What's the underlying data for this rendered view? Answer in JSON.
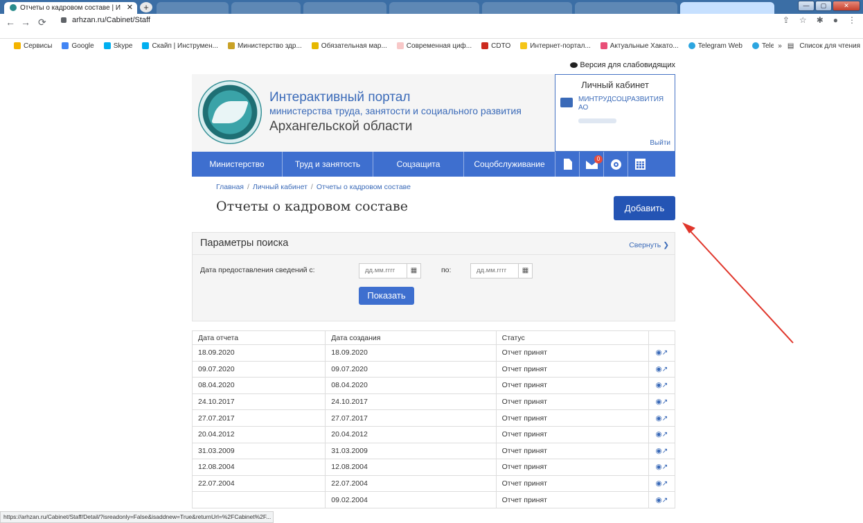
{
  "browser": {
    "active_tab_title": "Отчеты о кадровом составе | И",
    "url": "arhzan.ru/Cabinet/Staff",
    "bookmarks": [
      "Сервисы",
      "Google",
      "Skype",
      "Скайп | Инструмен...",
      "Министерство здр...",
      "Обязательная мар...",
      "Современная циф...",
      "CDTO",
      "Интернет-портал...",
      "Актуальные Хакато...",
      "Telegram Web",
      "Telegram Web"
    ],
    "reading_list": "Список для чтения",
    "status_url": "https://arhzan.ru/Cabinet/Staff/Detail/?isreadonly=False&isaddnew=True&returnUrl=%2FCabinet%2F..."
  },
  "header": {
    "low_vision": "Версия для слабовидящих",
    "title": "Интерактивный портал",
    "subtitle": "министерства труда, занятости и социального развития",
    "region": "Архангельской области"
  },
  "cabinet": {
    "title": "Личный кабинет",
    "org": "МИНТРУДСОЦРАЗВИТИЯ АО",
    "logout": "Выйти"
  },
  "nav": {
    "items": [
      "Министерство",
      "Труд и занятость",
      "Соцзащита",
      "Соцобслуживание"
    ],
    "mail_badge": "0"
  },
  "breadcrumb": [
    "Главная",
    "Личный кабинет",
    "Отчеты о кадровом составе"
  ],
  "page_title": "Отчеты о кадровом составе",
  "add_button": "Добавить",
  "search": {
    "title": "Параметры поиска",
    "collapse": "Свернуть",
    "date_from_label": "Дата предоставления сведений с:",
    "date_from_placeholder": "дд.мм.гггг",
    "date_to_label": "по:",
    "date_to_placeholder": "дд.мм.гггг",
    "show_button": "Показать"
  },
  "table": {
    "headers": [
      "Дата отчета",
      "Дата создания",
      "Статус",
      ""
    ],
    "rows": [
      [
        "18.09.2020",
        "18.09.2020",
        "Отчет принят"
      ],
      [
        "09.07.2020",
        "09.07.2020",
        "Отчет принят"
      ],
      [
        "08.04.2020",
        "08.04.2020",
        "Отчет принят"
      ],
      [
        "24.10.2017",
        "24.10.2017",
        "Отчет принят"
      ],
      [
        "27.07.2017",
        "27.07.2017",
        "Отчет принят"
      ],
      [
        "20.04.2012",
        "20.04.2012",
        "Отчет принят"
      ],
      [
        "31.03.2009",
        "31.03.2009",
        "Отчет принят"
      ],
      [
        "12.08.2004",
        "12.08.2004",
        "Отчет принят"
      ],
      [
        "22.07.2004",
        "22.07.2004",
        "Отчет принят"
      ],
      [
        "",
        "09.02.2004",
        "Отчет принят"
      ]
    ]
  },
  "colors": {
    "accent": "#3e6fcf",
    "add_button": "#2454b4",
    "annotation_arrow": "#e0362b"
  }
}
